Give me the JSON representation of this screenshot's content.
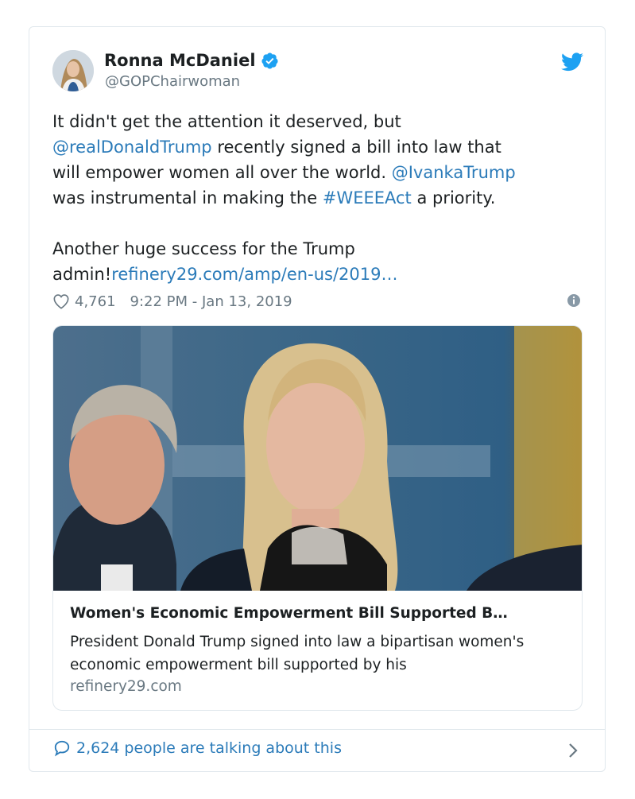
{
  "author": {
    "name": "Ronna McDaniel",
    "handle": "@GOPChairwoman",
    "verified": true
  },
  "tweet": {
    "line1": "It didn't get the attention it deserved, but",
    "mention1": "@realDonaldTrump",
    "line2_rest": " recently signed a bill into law that",
    "line3": "will empower women all over the world. ",
    "mention2": "@IvankaTrump",
    "line4_start": "was instrumental in making the ",
    "hashtag": "#WEEEAct",
    "line4_end": " a priority.",
    "line5": "Another huge success for the Trump",
    "line6_start": "admin!",
    "link": "refinery29.com/amp/en-us/2019…"
  },
  "meta": {
    "likes": "4,761",
    "timestamp": "9:22 PM - Jan 13, 2019"
  },
  "card": {
    "title": "Women's Economic Empowerment Bill Supported B…",
    "description": "President Donald Trump signed into law a bipartisan women's economic empowerment bill supported by his",
    "domain": "refinery29.com"
  },
  "footer": {
    "conversation": "2,624 people are talking about this"
  },
  "colors": {
    "link": "#2b7bb9",
    "verified": "#1da1f2",
    "muted": "#697882",
    "border": "#e1e8ed"
  }
}
